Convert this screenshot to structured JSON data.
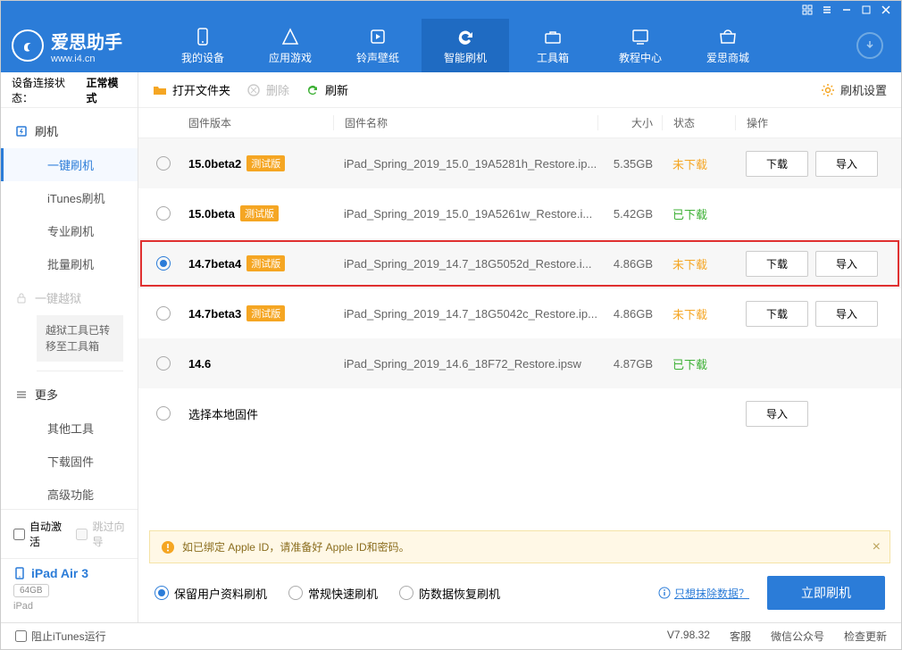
{
  "window_controls": [
    "grid",
    "settings",
    "minimize",
    "maximize",
    "close"
  ],
  "logo": {
    "title": "爱思助手",
    "subtitle": "www.i4.cn"
  },
  "nav": [
    {
      "id": "device",
      "label": "我的设备"
    },
    {
      "id": "apps",
      "label": "应用游戏"
    },
    {
      "id": "ringtone",
      "label": "铃声壁纸"
    },
    {
      "id": "flash",
      "label": "智能刷机",
      "active": true
    },
    {
      "id": "tools",
      "label": "工具箱"
    },
    {
      "id": "tutorial",
      "label": "教程中心"
    },
    {
      "id": "store",
      "label": "爱思商城"
    }
  ],
  "connection": {
    "label": "设备连接状态：",
    "value": "正常模式"
  },
  "sidebar": {
    "flash_head": "刷机",
    "items": [
      "一键刷机",
      "iTunes刷机",
      "专业刷机",
      "批量刷机"
    ],
    "items_active": 0,
    "jailbreak_head": "一键越狱",
    "jailbreak_note": "越狱工具已转移至工具箱",
    "more_head": "更多",
    "more_items": [
      "其他工具",
      "下载固件",
      "高级功能"
    ]
  },
  "toolbar": {
    "open": "打开文件夹",
    "delete": "删除",
    "refresh": "刷新",
    "settings": "刷机设置"
  },
  "columns": {
    "version": "固件版本",
    "name": "固件名称",
    "size": "大小",
    "status": "状态",
    "action": "操作"
  },
  "beta_tag": "测试版",
  "actions": {
    "download": "下载",
    "import": "导入"
  },
  "status_labels": {
    "not": "未下载",
    "done": "已下载"
  },
  "rows": [
    {
      "version": "15.0beta2",
      "beta": true,
      "name": "iPad_Spring_2019_15.0_19A5281h_Restore.ip...",
      "size": "5.35GB",
      "status": "not",
      "download": true,
      "import": true
    },
    {
      "version": "15.0beta",
      "beta": true,
      "name": "iPad_Spring_2019_15.0_19A5261w_Restore.i...",
      "size": "5.42GB",
      "status": "done"
    },
    {
      "version": "14.7beta4",
      "beta": true,
      "name": "iPad_Spring_2019_14.7_18G5052d_Restore.i...",
      "size": "4.86GB",
      "status": "not",
      "download": true,
      "import": true,
      "selected": true,
      "highlight": true
    },
    {
      "version": "14.7beta3",
      "beta": true,
      "name": "iPad_Spring_2019_14.7_18G5042c_Restore.ip...",
      "size": "4.86GB",
      "status": "not",
      "download": true,
      "import": true
    },
    {
      "version": "14.6",
      "beta": false,
      "name": "iPad_Spring_2019_14.6_18F72_Restore.ipsw",
      "size": "4.87GB",
      "status": "done"
    }
  ],
  "local_row_label": "选择本地固件",
  "alert": "如已绑定 Apple ID，请准备好 Apple ID和密码。",
  "options": {
    "items": [
      "保留用户资料刷机",
      "常规快速刷机",
      "防数据恢复刷机"
    ],
    "selected": 0,
    "erase_link": "只想抹除数据？",
    "flash_now": "立即刷机"
  },
  "side_checks": {
    "auto_activate": "自动激活",
    "skip_guide": "跳过向导"
  },
  "device": {
    "name": "iPad Air 3",
    "storage": "64GB",
    "os": "iPad"
  },
  "footer": {
    "block_itunes": "阻止iTunes运行",
    "version": "V7.98.32",
    "links": [
      "客服",
      "微信公众号",
      "检查更新"
    ]
  }
}
